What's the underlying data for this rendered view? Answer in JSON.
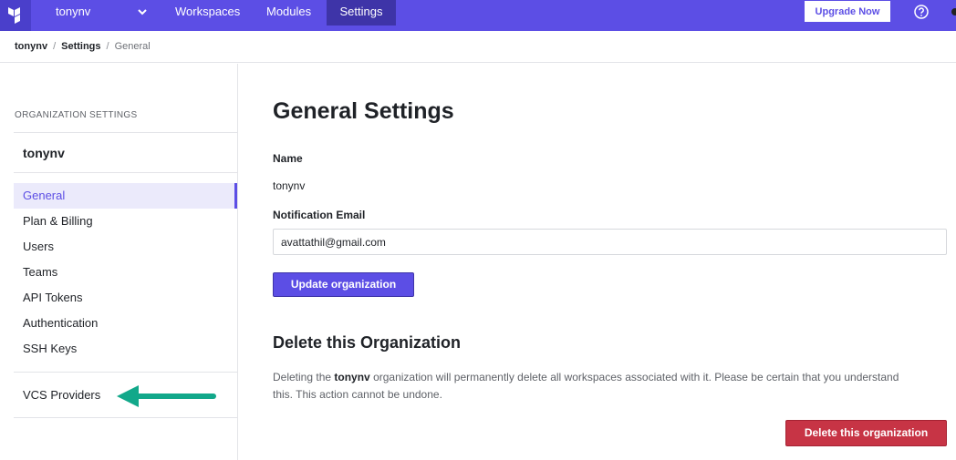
{
  "topnav": {
    "org_name": "tonynv",
    "items": [
      {
        "label": "Workspaces"
      },
      {
        "label": "Modules"
      },
      {
        "label": "Settings",
        "active": true
      }
    ],
    "upgrade_label": "Upgrade Now",
    "accent_color": "#5c4ee5"
  },
  "breadcrumb": {
    "items": [
      "tonynv",
      "Settings",
      "General"
    ],
    "separator": "/"
  },
  "sidebar": {
    "heading": "ORGANIZATION SETTINGS",
    "org_name": "tonynv",
    "items": [
      {
        "label": "General",
        "active": true
      },
      {
        "label": "Plan & Billing"
      },
      {
        "label": "Users"
      },
      {
        "label": "Teams"
      },
      {
        "label": "API Tokens"
      },
      {
        "label": "Authentication"
      },
      {
        "label": "SSH Keys"
      }
    ],
    "vcs_label": "VCS Providers"
  },
  "main": {
    "title": "General Settings",
    "name_label": "Name",
    "name_value": "tonynv",
    "email_label": "Notification Email",
    "email_value": "avattathil@gmail.com",
    "update_button": "Update organization",
    "delete_title": "Delete this Organization",
    "delete_desc_prefix": "Deleting the",
    "delete_desc_org": "tonynv",
    "delete_desc_suffix": "organization will permanently delete all workspaces associated with it. Please be certain that you understand this. This action cannot be undone.",
    "delete_button": "Delete this organization",
    "danger_color": "#c73445"
  },
  "annotation": {
    "arrow_color": "#12a88a"
  }
}
